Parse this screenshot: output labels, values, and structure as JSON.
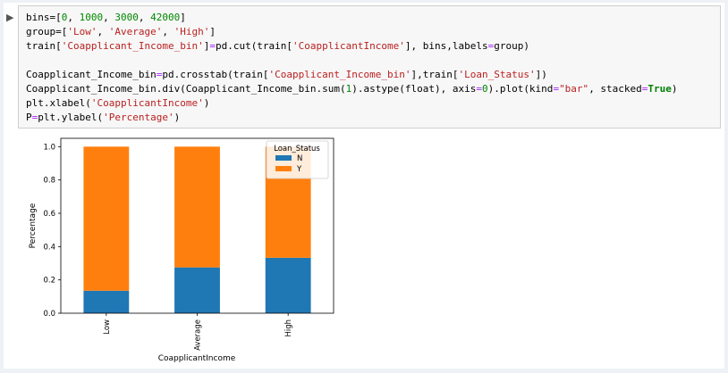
{
  "cell": {
    "code_lines": [
      [
        [
          "plain",
          "bins=["
        ],
        [
          "num",
          "0"
        ],
        [
          "plain",
          ", "
        ],
        [
          "num",
          "1000"
        ],
        [
          "plain",
          ", "
        ],
        [
          "num",
          "3000"
        ],
        [
          "plain",
          ", "
        ],
        [
          "num",
          "42000"
        ],
        [
          "plain",
          "]"
        ]
      ],
      [
        [
          "plain",
          "group=["
        ],
        [
          "str",
          "'Low'"
        ],
        [
          "plain",
          ", "
        ],
        [
          "str",
          "'Average'"
        ],
        [
          "plain",
          ", "
        ],
        [
          "str",
          "'High'"
        ],
        [
          "plain",
          "]"
        ]
      ],
      [
        [
          "plain",
          "train["
        ],
        [
          "str",
          "'Coapplicant_Income_bin'"
        ],
        [
          "plain",
          "]"
        ],
        [
          "op",
          "="
        ],
        [
          "plain",
          "pd.cut(train["
        ],
        [
          "str",
          "'CoapplicantIncome'"
        ],
        [
          "plain",
          "], bins,labels"
        ],
        [
          "op",
          "="
        ],
        [
          "plain",
          "group)"
        ]
      ],
      [
        [
          "plain",
          ""
        ]
      ],
      [
        [
          "plain",
          "Coapplicant_Income_bin"
        ],
        [
          "op",
          "="
        ],
        [
          "plain",
          "pd.crosstab(train["
        ],
        [
          "str",
          "'Coapplicant_Income_bin'"
        ],
        [
          "plain",
          "],train["
        ],
        [
          "str",
          "'Loan_Status'"
        ],
        [
          "plain",
          "])"
        ]
      ],
      [
        [
          "plain",
          "Coapplicant_Income_bin.div(Coapplicant_Income_bin.sum("
        ],
        [
          "num",
          "1"
        ],
        [
          "plain",
          ").astype(float), axis"
        ],
        [
          "op",
          "="
        ],
        [
          "num",
          "0"
        ],
        [
          "plain",
          ").plot(kind"
        ],
        [
          "op",
          "="
        ],
        [
          "str",
          "\"bar\""
        ],
        [
          "plain",
          ", stacked"
        ],
        [
          "op",
          "="
        ],
        [
          "kw",
          "True"
        ],
        [
          "plain",
          ")"
        ]
      ],
      [
        [
          "plain",
          "plt.xlabel("
        ],
        [
          "str",
          "'CoapplicantIncome'"
        ],
        [
          "plain",
          ")"
        ]
      ],
      [
        [
          "plain",
          "P"
        ],
        [
          "op",
          "="
        ],
        [
          "plain",
          "plt.ylabel("
        ],
        [
          "str",
          "'Percentage'"
        ],
        [
          "plain",
          ")"
        ]
      ]
    ]
  },
  "chart_data": {
    "type": "bar",
    "stacked": true,
    "categories": [
      "Low",
      "Average",
      "High"
    ],
    "series": [
      {
        "name": "N",
        "values": [
          0.135,
          0.275,
          0.333
        ],
        "color": "#1f77b4"
      },
      {
        "name": "Y",
        "values": [
          0.865,
          0.725,
          0.667
        ],
        "color": "#ff7f0e"
      }
    ],
    "xlabel": "CoapplicantIncome",
    "ylabel": "Percentage",
    "ylim": [
      0,
      1.05
    ],
    "yticks": [
      "0.0",
      "0.2",
      "0.4",
      "0.6",
      "0.8",
      "1.0"
    ],
    "legend_title": "Loan_Status",
    "legend_placement": "top-right",
    "grid": false
  }
}
